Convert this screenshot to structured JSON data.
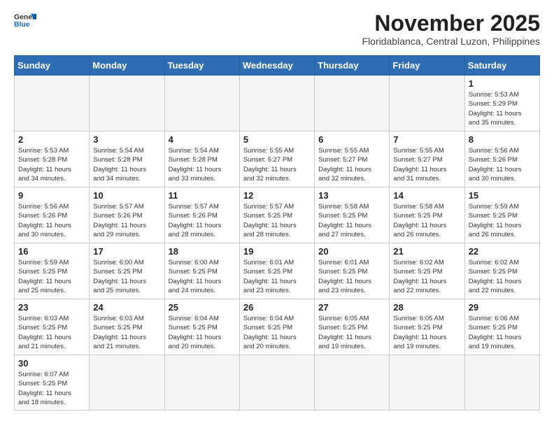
{
  "header": {
    "logo_line1": "General",
    "logo_line2": "Blue",
    "month": "November 2025",
    "location": "Floridablanca, Central Luzon, Philippines"
  },
  "weekdays": [
    "Sunday",
    "Monday",
    "Tuesday",
    "Wednesday",
    "Thursday",
    "Friday",
    "Saturday"
  ],
  "weeks": [
    [
      {
        "day": "",
        "info": ""
      },
      {
        "day": "",
        "info": ""
      },
      {
        "day": "",
        "info": ""
      },
      {
        "day": "",
        "info": ""
      },
      {
        "day": "",
        "info": ""
      },
      {
        "day": "",
        "info": ""
      },
      {
        "day": "1",
        "info": "Sunrise: 5:53 AM\nSunset: 5:29 PM\nDaylight: 11 hours\nand 35 minutes."
      }
    ],
    [
      {
        "day": "2",
        "info": "Sunrise: 5:53 AM\nSunset: 5:28 PM\nDaylight: 11 hours\nand 34 minutes."
      },
      {
        "day": "3",
        "info": "Sunrise: 5:54 AM\nSunset: 5:28 PM\nDaylight: 11 hours\nand 34 minutes."
      },
      {
        "day": "4",
        "info": "Sunrise: 5:54 AM\nSunset: 5:28 PM\nDaylight: 11 hours\nand 33 minutes."
      },
      {
        "day": "5",
        "info": "Sunrise: 5:55 AM\nSunset: 5:27 PM\nDaylight: 11 hours\nand 32 minutes."
      },
      {
        "day": "6",
        "info": "Sunrise: 5:55 AM\nSunset: 5:27 PM\nDaylight: 11 hours\nand 32 minutes."
      },
      {
        "day": "7",
        "info": "Sunrise: 5:55 AM\nSunset: 5:27 PM\nDaylight: 11 hours\nand 31 minutes."
      },
      {
        "day": "8",
        "info": "Sunrise: 5:56 AM\nSunset: 5:26 PM\nDaylight: 11 hours\nand 30 minutes."
      }
    ],
    [
      {
        "day": "9",
        "info": "Sunrise: 5:56 AM\nSunset: 5:26 PM\nDaylight: 11 hours\nand 30 minutes."
      },
      {
        "day": "10",
        "info": "Sunrise: 5:57 AM\nSunset: 5:26 PM\nDaylight: 11 hours\nand 29 minutes."
      },
      {
        "day": "11",
        "info": "Sunrise: 5:57 AM\nSunset: 5:26 PM\nDaylight: 11 hours\nand 28 minutes."
      },
      {
        "day": "12",
        "info": "Sunrise: 5:57 AM\nSunset: 5:25 PM\nDaylight: 11 hours\nand 28 minutes."
      },
      {
        "day": "13",
        "info": "Sunrise: 5:58 AM\nSunset: 5:25 PM\nDaylight: 11 hours\nand 27 minutes."
      },
      {
        "day": "14",
        "info": "Sunrise: 5:58 AM\nSunset: 5:25 PM\nDaylight: 11 hours\nand 26 minutes."
      },
      {
        "day": "15",
        "info": "Sunrise: 5:59 AM\nSunset: 5:25 PM\nDaylight: 11 hours\nand 26 minutes."
      }
    ],
    [
      {
        "day": "16",
        "info": "Sunrise: 5:59 AM\nSunset: 5:25 PM\nDaylight: 11 hours\nand 25 minutes."
      },
      {
        "day": "17",
        "info": "Sunrise: 6:00 AM\nSunset: 5:25 PM\nDaylight: 11 hours\nand 25 minutes."
      },
      {
        "day": "18",
        "info": "Sunrise: 6:00 AM\nSunset: 5:25 PM\nDaylight: 11 hours\nand 24 minutes."
      },
      {
        "day": "19",
        "info": "Sunrise: 6:01 AM\nSunset: 5:25 PM\nDaylight: 11 hours\nand 23 minutes."
      },
      {
        "day": "20",
        "info": "Sunrise: 6:01 AM\nSunset: 5:25 PM\nDaylight: 11 hours\nand 23 minutes."
      },
      {
        "day": "21",
        "info": "Sunrise: 6:02 AM\nSunset: 5:25 PM\nDaylight: 11 hours\nand 22 minutes."
      },
      {
        "day": "22",
        "info": "Sunrise: 6:02 AM\nSunset: 5:25 PM\nDaylight: 11 hours\nand 22 minutes."
      }
    ],
    [
      {
        "day": "23",
        "info": "Sunrise: 6:03 AM\nSunset: 5:25 PM\nDaylight: 11 hours\nand 21 minutes."
      },
      {
        "day": "24",
        "info": "Sunrise: 6:03 AM\nSunset: 5:25 PM\nDaylight: 11 hours\nand 21 minutes."
      },
      {
        "day": "25",
        "info": "Sunrise: 6:04 AM\nSunset: 5:25 PM\nDaylight: 11 hours\nand 20 minutes."
      },
      {
        "day": "26",
        "info": "Sunrise: 6:04 AM\nSunset: 5:25 PM\nDaylight: 11 hours\nand 20 minutes."
      },
      {
        "day": "27",
        "info": "Sunrise: 6:05 AM\nSunset: 5:25 PM\nDaylight: 11 hours\nand 19 minutes."
      },
      {
        "day": "28",
        "info": "Sunrise: 6:05 AM\nSunset: 5:25 PM\nDaylight: 11 hours\nand 19 minutes."
      },
      {
        "day": "29",
        "info": "Sunrise: 6:06 AM\nSunset: 5:25 PM\nDaylight: 11 hours\nand 19 minutes."
      }
    ],
    [
      {
        "day": "30",
        "info": "Sunrise: 6:07 AM\nSunset: 5:25 PM\nDaylight: 11 hours\nand 18 minutes."
      },
      {
        "day": "",
        "info": ""
      },
      {
        "day": "",
        "info": ""
      },
      {
        "day": "",
        "info": ""
      },
      {
        "day": "",
        "info": ""
      },
      {
        "day": "",
        "info": ""
      },
      {
        "day": "",
        "info": ""
      }
    ]
  ]
}
